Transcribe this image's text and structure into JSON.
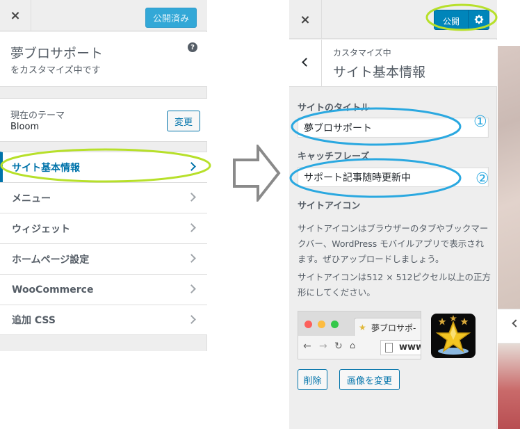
{
  "left": {
    "close_icon": "×",
    "publish_label": "公開済み",
    "site_name": "夢ブロサポート",
    "site_sub": "をカスタマイズ中です",
    "help_icon": "?",
    "theme_label": "現在のテーマ",
    "theme_name": "Bloom",
    "change_label": "変更",
    "menu": [
      {
        "label": "サイト基本情報"
      },
      {
        "label": "メニュー"
      },
      {
        "label": "ウィジェット"
      },
      {
        "label": "ホームページ設定"
      },
      {
        "label": "WooCommerce"
      },
      {
        "label": "追加 CSS"
      }
    ]
  },
  "right": {
    "close_icon": "×",
    "publish_label": "公開",
    "customizing_label": "カスタマイズ中",
    "section_title": "サイト基本情報",
    "site_title_label": "サイトのタイトル",
    "site_title_value": "夢ブロサポート",
    "tagline_label": "キャッチフレーズ",
    "tagline_value": "サポート記事随時更新中",
    "site_icon_label": "サイトアイコン",
    "site_icon_desc1": "サイトアイコンはブラウザーのタブやブックマークバー、WordPress モバイルアプリで表示されます。ぜひアップロードしましょう。",
    "site_icon_desc2": "サイトアイコンは512 × 512ピクセル以上の正方形にしてください。",
    "browser_tab_title": "夢ブロサポ-",
    "browser_url": "www.",
    "remove_label": "削除",
    "change_image_label": "画像を変更"
  },
  "annotations": {
    "num1": "①",
    "num2": "②"
  },
  "colors": {
    "accent_blue": "#0073aa",
    "publish_blue": "#0085ba",
    "highlight_green": "#b7e02a",
    "highlight_cyan": "#2aa8e0"
  }
}
